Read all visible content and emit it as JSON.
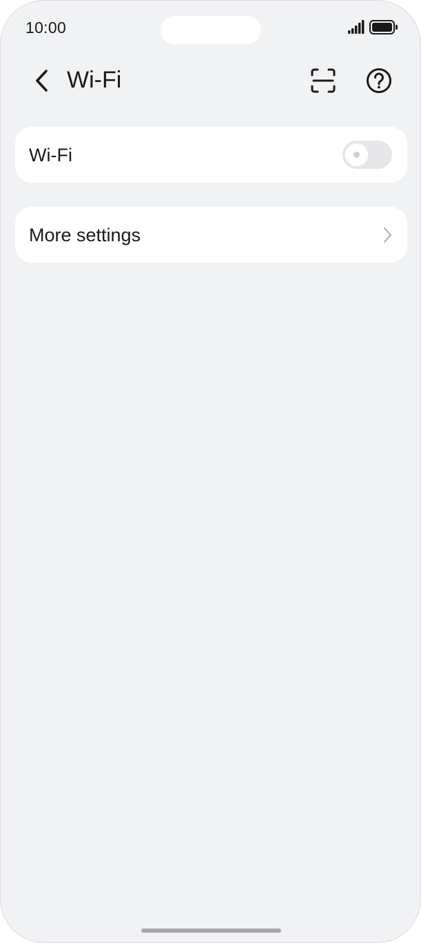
{
  "status_bar": {
    "time": "10:00",
    "signal_icon": "cellular-signal-icon",
    "battery_icon": "battery-full-icon"
  },
  "nav": {
    "title": "Wi-Fi",
    "back_icon": "chevron-left-icon",
    "scan_icon": "scan-qr-icon",
    "help_icon": "help-question-icon"
  },
  "wifi_card": {
    "label": "Wi-Fi",
    "toggle_state": "off"
  },
  "more_card": {
    "label": "More settings",
    "chevron_icon": "chevron-right-icon"
  },
  "colors": {
    "background": "#f1f2f4",
    "card": "#ffffff",
    "toggle_off": "#e6e6e8",
    "text": "#1a1a1a"
  }
}
